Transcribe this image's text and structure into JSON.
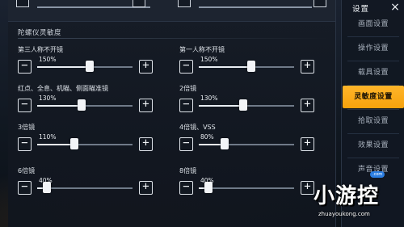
{
  "sidebar": {
    "title": "设置",
    "close_glyph": "×",
    "items": [
      {
        "label": "画面设置"
      },
      {
        "label": "操作设置"
      },
      {
        "label": "载具设置"
      },
      {
        "label": "灵敏度设置"
      },
      {
        "label": "拾取设置"
      },
      {
        "label": "效果设置"
      },
      {
        "label": "声音设置"
      }
    ],
    "active_index": 3,
    "active_color": "#F7A20C"
  },
  "section": {
    "title": "陀螺仪灵敏度"
  },
  "settings": [
    {
      "label": "第三人称不开镜",
      "value": "150%",
      "level": 0.55
    },
    {
      "label": "第一人称不开镜",
      "value": "150%",
      "level": 0.55
    },
    {
      "label": "红点、全息、机瞄、侧面瞄准镜",
      "value": "130%",
      "level": 0.47
    },
    {
      "label": "2倍镜",
      "value": "130%",
      "level": 0.47
    },
    {
      "label": "3倍镜",
      "value": "110%",
      "level": 0.39
    },
    {
      "label": "4倍镜、VSS",
      "value": "80%",
      "level": 0.27
    },
    {
      "label": "6倍镜",
      "value": "40%",
      "level": 0.1
    },
    {
      "label": "8倍镜",
      "value": "40%",
      "level": 0.1
    }
  ],
  "buttons": {
    "minus": "−",
    "plus": "+"
  },
  "watermark": {
    "brand": "小游控",
    "url": "zhuayoukong.com",
    "badge": ".com"
  }
}
